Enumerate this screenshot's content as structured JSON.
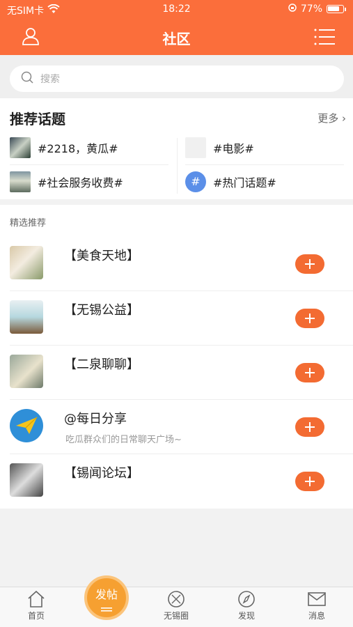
{
  "status_bar": {
    "carrier": "无SIM卡",
    "time": "18:22",
    "battery": "77%"
  },
  "header": {
    "title": "社区"
  },
  "search": {
    "placeholder": "搜索"
  },
  "recommended_topics": {
    "title": "推荐话题",
    "more": "更多",
    "items": [
      {
        "label": "#2218，黄瓜#"
      },
      {
        "label": "#电影#"
      },
      {
        "label": "#社会服务收费#"
      },
      {
        "label": "#热门话题#"
      }
    ]
  },
  "featured": {
    "title": "精选推荐",
    "items": [
      {
        "name": "【美食天地】",
        "desc": ""
      },
      {
        "name": "【无锡公益】",
        "desc": ""
      },
      {
        "name": "【二泉聊聊】",
        "desc": ""
      },
      {
        "name": "@每日分享",
        "desc": "吃瓜群众们的日常聊天广场~"
      },
      {
        "name": "【锡闻论坛】",
        "desc": ""
      }
    ]
  },
  "tabbar": {
    "home": "首页",
    "post": "发帖",
    "circle": "无锡圈",
    "discover": "发现",
    "messages": "消息"
  },
  "colors": {
    "brand": "#fb6e3b",
    "add_button": "#f36b32",
    "post_button": "#f6a031"
  }
}
